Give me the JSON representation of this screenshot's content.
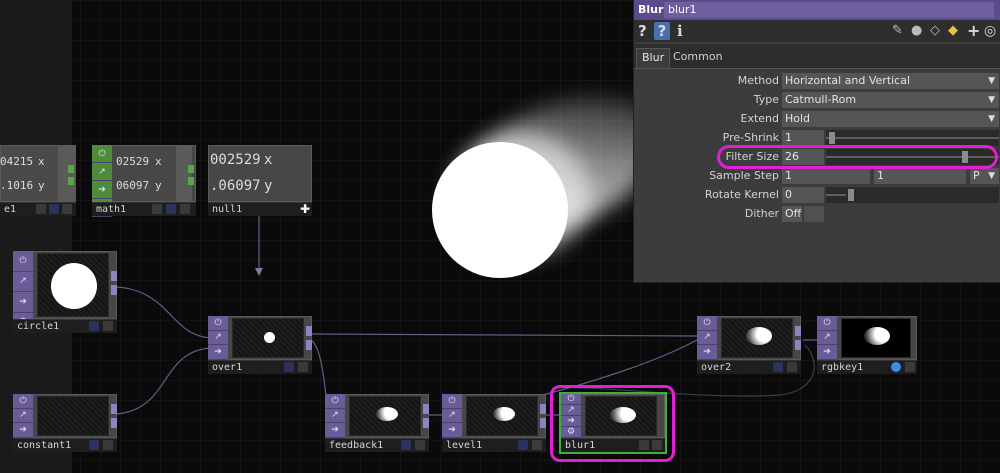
{
  "network": {
    "nodes": {
      "partial1": {
        "label": "e1",
        "val_x": "04215",
        "val_y": ".1016",
        "axis_x": "x",
        "axis_y": "y"
      },
      "math1": {
        "label": "math1",
        "val_x": "02529",
        "val_y": "06097",
        "axis_x": "x",
        "axis_y": "y"
      },
      "null1": {
        "label": "null1",
        "val_x": "002529",
        "val_y": ".06097",
        "axis_x": "x",
        "axis_y": "y"
      },
      "circle1": {
        "label": "circle1"
      },
      "constant1": {
        "label": "constant1"
      },
      "over1": {
        "label": "over1"
      },
      "feedback1": {
        "label": "feedback1"
      },
      "level1": {
        "label": "level1"
      },
      "blur1": {
        "label": "blur1"
      },
      "over2": {
        "label": "over2"
      },
      "rgbkey1": {
        "label": "rgbkey1"
      }
    },
    "colors": {
      "highlight": "#e31fd6",
      "top_family": "#6a5c96",
      "chop_family": "#58a84a",
      "selected": "#3fae3f"
    }
  },
  "parameters": {
    "op_type": "Blur",
    "op_name": "blur1",
    "toolbar_icons": [
      "help-icon",
      "python-help-icon",
      "info-icon",
      "edit-icon",
      "comment-icon",
      "clone-icon",
      "python-icon",
      "add-icon",
      "target-icon"
    ],
    "tabs": [
      {
        "label": "Blur",
        "active": true
      },
      {
        "label": "Common",
        "active": false
      }
    ],
    "rows": [
      {
        "label": "Method",
        "value": "Horizontal and Vertical",
        "kind": "menu"
      },
      {
        "label": "Type",
        "value": "Catmull-Rom",
        "kind": "menu"
      },
      {
        "label": "Extend",
        "value": "Hold",
        "kind": "menu"
      },
      {
        "label": "Pre-Shrink",
        "value": "1",
        "kind": "slider"
      },
      {
        "label": "Filter Size",
        "value": "26",
        "kind": "slider"
      },
      {
        "label": "Sample Step",
        "value": "1",
        "value2": "1",
        "unit": "P",
        "kind": "multi"
      },
      {
        "label": "Rotate Kernel",
        "value": "0",
        "kind": "slider"
      },
      {
        "label": "Dither",
        "value": "Off",
        "kind": "toggle"
      }
    ]
  }
}
